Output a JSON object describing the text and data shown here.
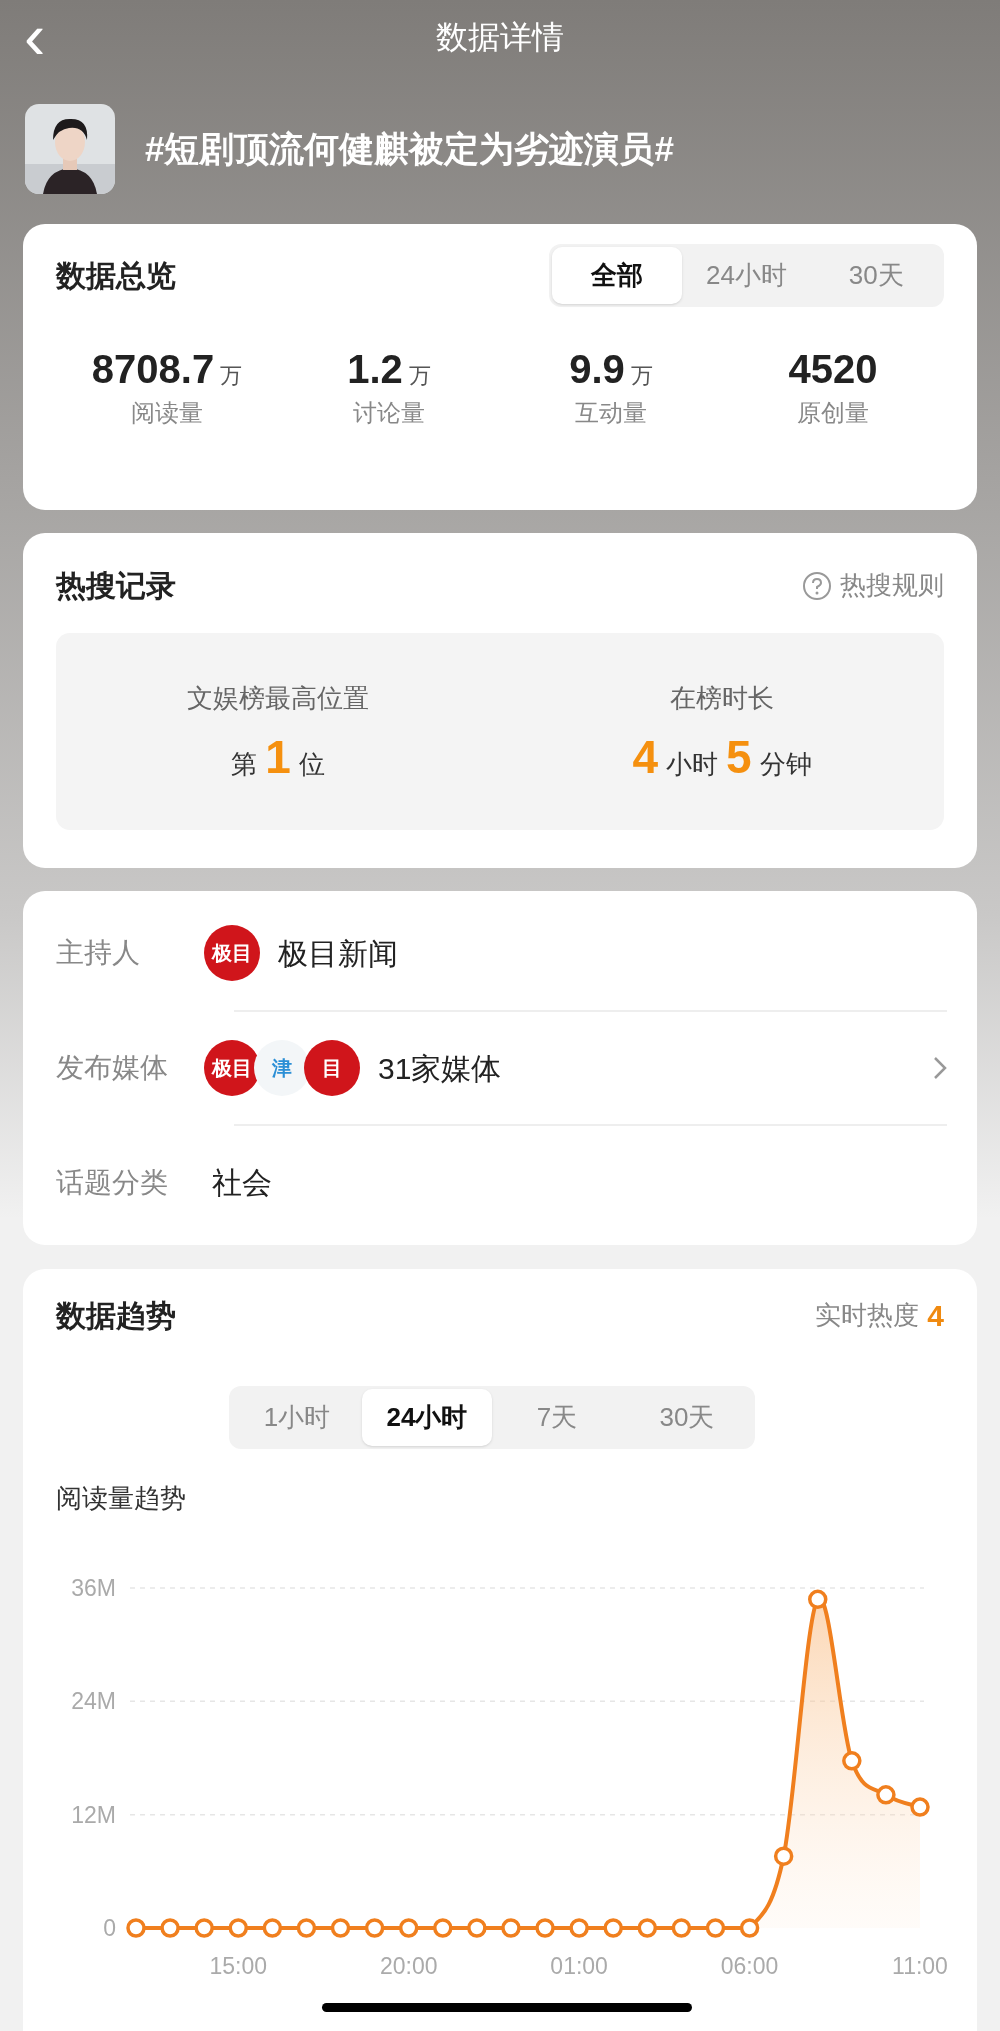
{
  "nav": {
    "back_icon": "‹",
    "title": "数据详情"
  },
  "topic": {
    "title": "#短剧顶流何健麒被定为劣迹演员#"
  },
  "overview": {
    "title": "数据总览",
    "tabs": [
      {
        "label": "全部",
        "selected": true
      },
      {
        "label": "24小时",
        "selected": false
      },
      {
        "label": "30天",
        "selected": false
      }
    ],
    "stats": [
      {
        "value": "8708.7",
        "unit": "万",
        "label": "阅读量"
      },
      {
        "value": "1.2",
        "unit": "万",
        "label": "讨论量"
      },
      {
        "value": "9.9",
        "unit": "万",
        "label": "互动量"
      },
      {
        "value": "4520",
        "label": "原创量"
      }
    ]
  },
  "hot_search": {
    "title": "热搜记录",
    "rules_link": "热搜规则",
    "records": [
      {
        "label": "文娱榜最高位置",
        "parts": [
          {
            "kind": "unit",
            "text": "第"
          },
          {
            "kind": "number",
            "text": "1"
          },
          {
            "kind": "unit",
            "text": "位"
          }
        ]
      },
      {
        "label": "在榜时长",
        "parts": [
          {
            "kind": "number",
            "text": "4"
          },
          {
            "kind": "unit",
            "text": "小时"
          },
          {
            "kind": "number",
            "text": "5"
          },
          {
            "kind": "unit",
            "text": "分钟"
          }
        ]
      }
    ]
  },
  "info": {
    "rows": [
      {
        "label": "主持人",
        "logos": [
          {
            "kind": "red",
            "text": "极目"
          }
        ],
        "value": "极目新闻",
        "has_arrow": false
      },
      {
        "label": "发布媒体",
        "logos": [
          {
            "kind": "red",
            "text": "极目"
          },
          {
            "kind": "blue",
            "text": "津"
          },
          {
            "kind": "red",
            "text": "目"
          }
        ],
        "value": "31家媒体",
        "has_arrow": true
      },
      {
        "label": "话题分类",
        "value": "社会",
        "has_arrow": false
      }
    ]
  },
  "trend": {
    "title": "数据趋势",
    "heat_label": "实时热度",
    "heat_value": "4",
    "tabs": [
      {
        "label": "1小时",
        "selected": false
      },
      {
        "label": "24小时",
        "selected": true
      },
      {
        "label": "7天",
        "selected": false
      },
      {
        "label": "30天",
        "selected": false
      }
    ],
    "chart_title": "阅读量趋势",
    "chart_data": {
      "type": "area",
      "categories": [
        null,
        null,
        null,
        "15:00",
        null,
        null,
        null,
        null,
        "20:00",
        null,
        null,
        null,
        null,
        "01:00",
        null,
        null,
        null,
        null,
        "06:00",
        null,
        null,
        null,
        null,
        "11:00"
      ],
      "series": [
        {
          "color": "#f07f1e",
          "values": [
            0,
            0,
            0,
            0,
            0,
            0,
            0,
            0,
            0,
            0,
            0,
            0,
            0,
            0,
            0,
            0,
            0,
            0,
            0,
            7.6,
            34.8,
            17.7,
            14.1,
            12.8
          ]
        }
      ],
      "ylim": [
        0,
        36
      ],
      "yticks": [
        {
          "value": 0,
          "label": "0"
        },
        {
          "value": 12,
          "label": "12M"
        },
        {
          "value": 24,
          "label": "24M"
        },
        {
          "value": 36,
          "label": "36M"
        }
      ]
    }
  }
}
